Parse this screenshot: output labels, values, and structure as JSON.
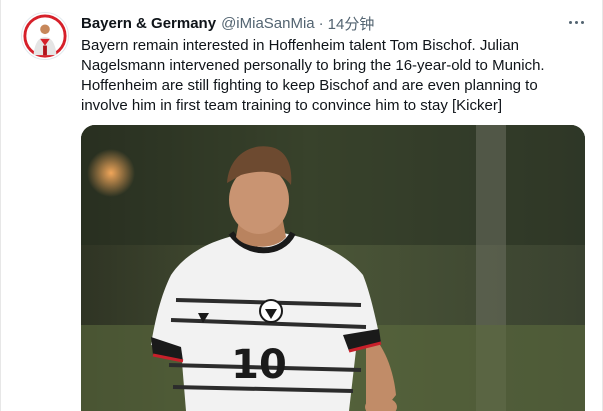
{
  "tweet": {
    "display_name": "Bayern & Germany",
    "handle": "@iMiaSanMia",
    "separator": "·",
    "timestamp": "14分钟",
    "text_lines": [
      "Bayern remain interested in Hoffenheim talent Tom Bischof. Julian",
      "Nagelsmann intervened personally to bring the 16-year-old to Munich.",
      "Hoffenheim are still fighting to keep Bischof and are even planning to",
      "involve him in first team training to convince him to stay [Kicker]"
    ],
    "more_icon": "more-horizontal-icon",
    "media": {
      "jersey_number": "10",
      "description_icon": "photo"
    }
  },
  "colors": {
    "text": "#0f1419",
    "secondary": "#536471",
    "border": "#e7e7e7"
  }
}
